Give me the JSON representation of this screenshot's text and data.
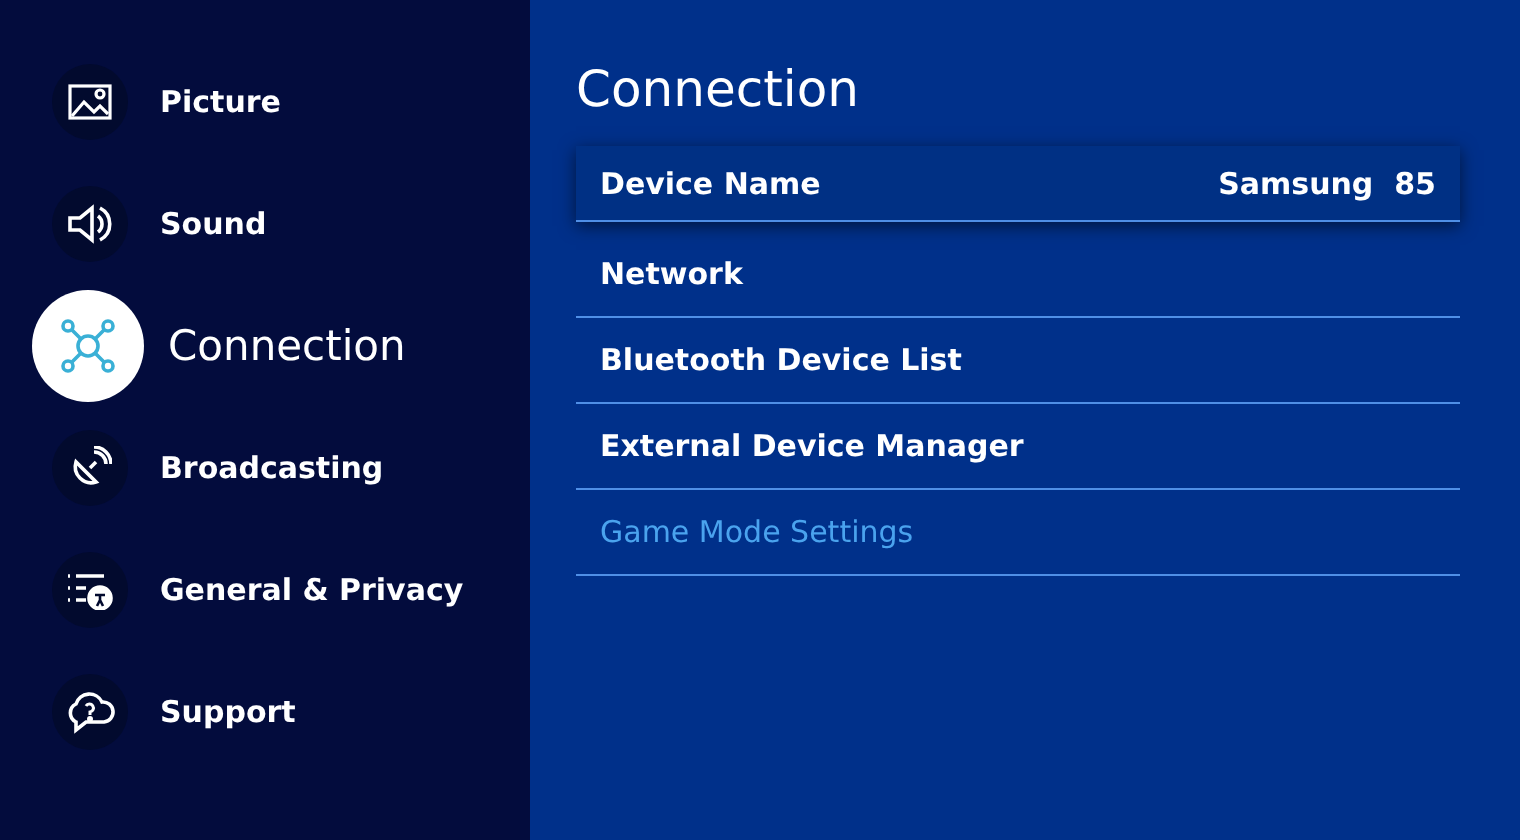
{
  "sidebar": {
    "items": [
      {
        "label": "Picture",
        "selected": false
      },
      {
        "label": "Sound",
        "selected": false
      },
      {
        "label": "Connection",
        "selected": true
      },
      {
        "label": "Broadcasting",
        "selected": false
      },
      {
        "label": "General & Privacy",
        "selected": false
      },
      {
        "label": "Support",
        "selected": false
      }
    ]
  },
  "panel": {
    "title": "Connection",
    "items": [
      {
        "label": "Device Name",
        "value": "Samsung  85",
        "selected": true,
        "disabled": false
      },
      {
        "label": "Network",
        "selected": false,
        "disabled": false
      },
      {
        "label": "Bluetooth Device List",
        "selected": false,
        "disabled": false
      },
      {
        "label": "External Device Manager",
        "selected": false,
        "disabled": false
      },
      {
        "label": "Game Mode Settings",
        "selected": false,
        "disabled": true
      }
    ]
  }
}
